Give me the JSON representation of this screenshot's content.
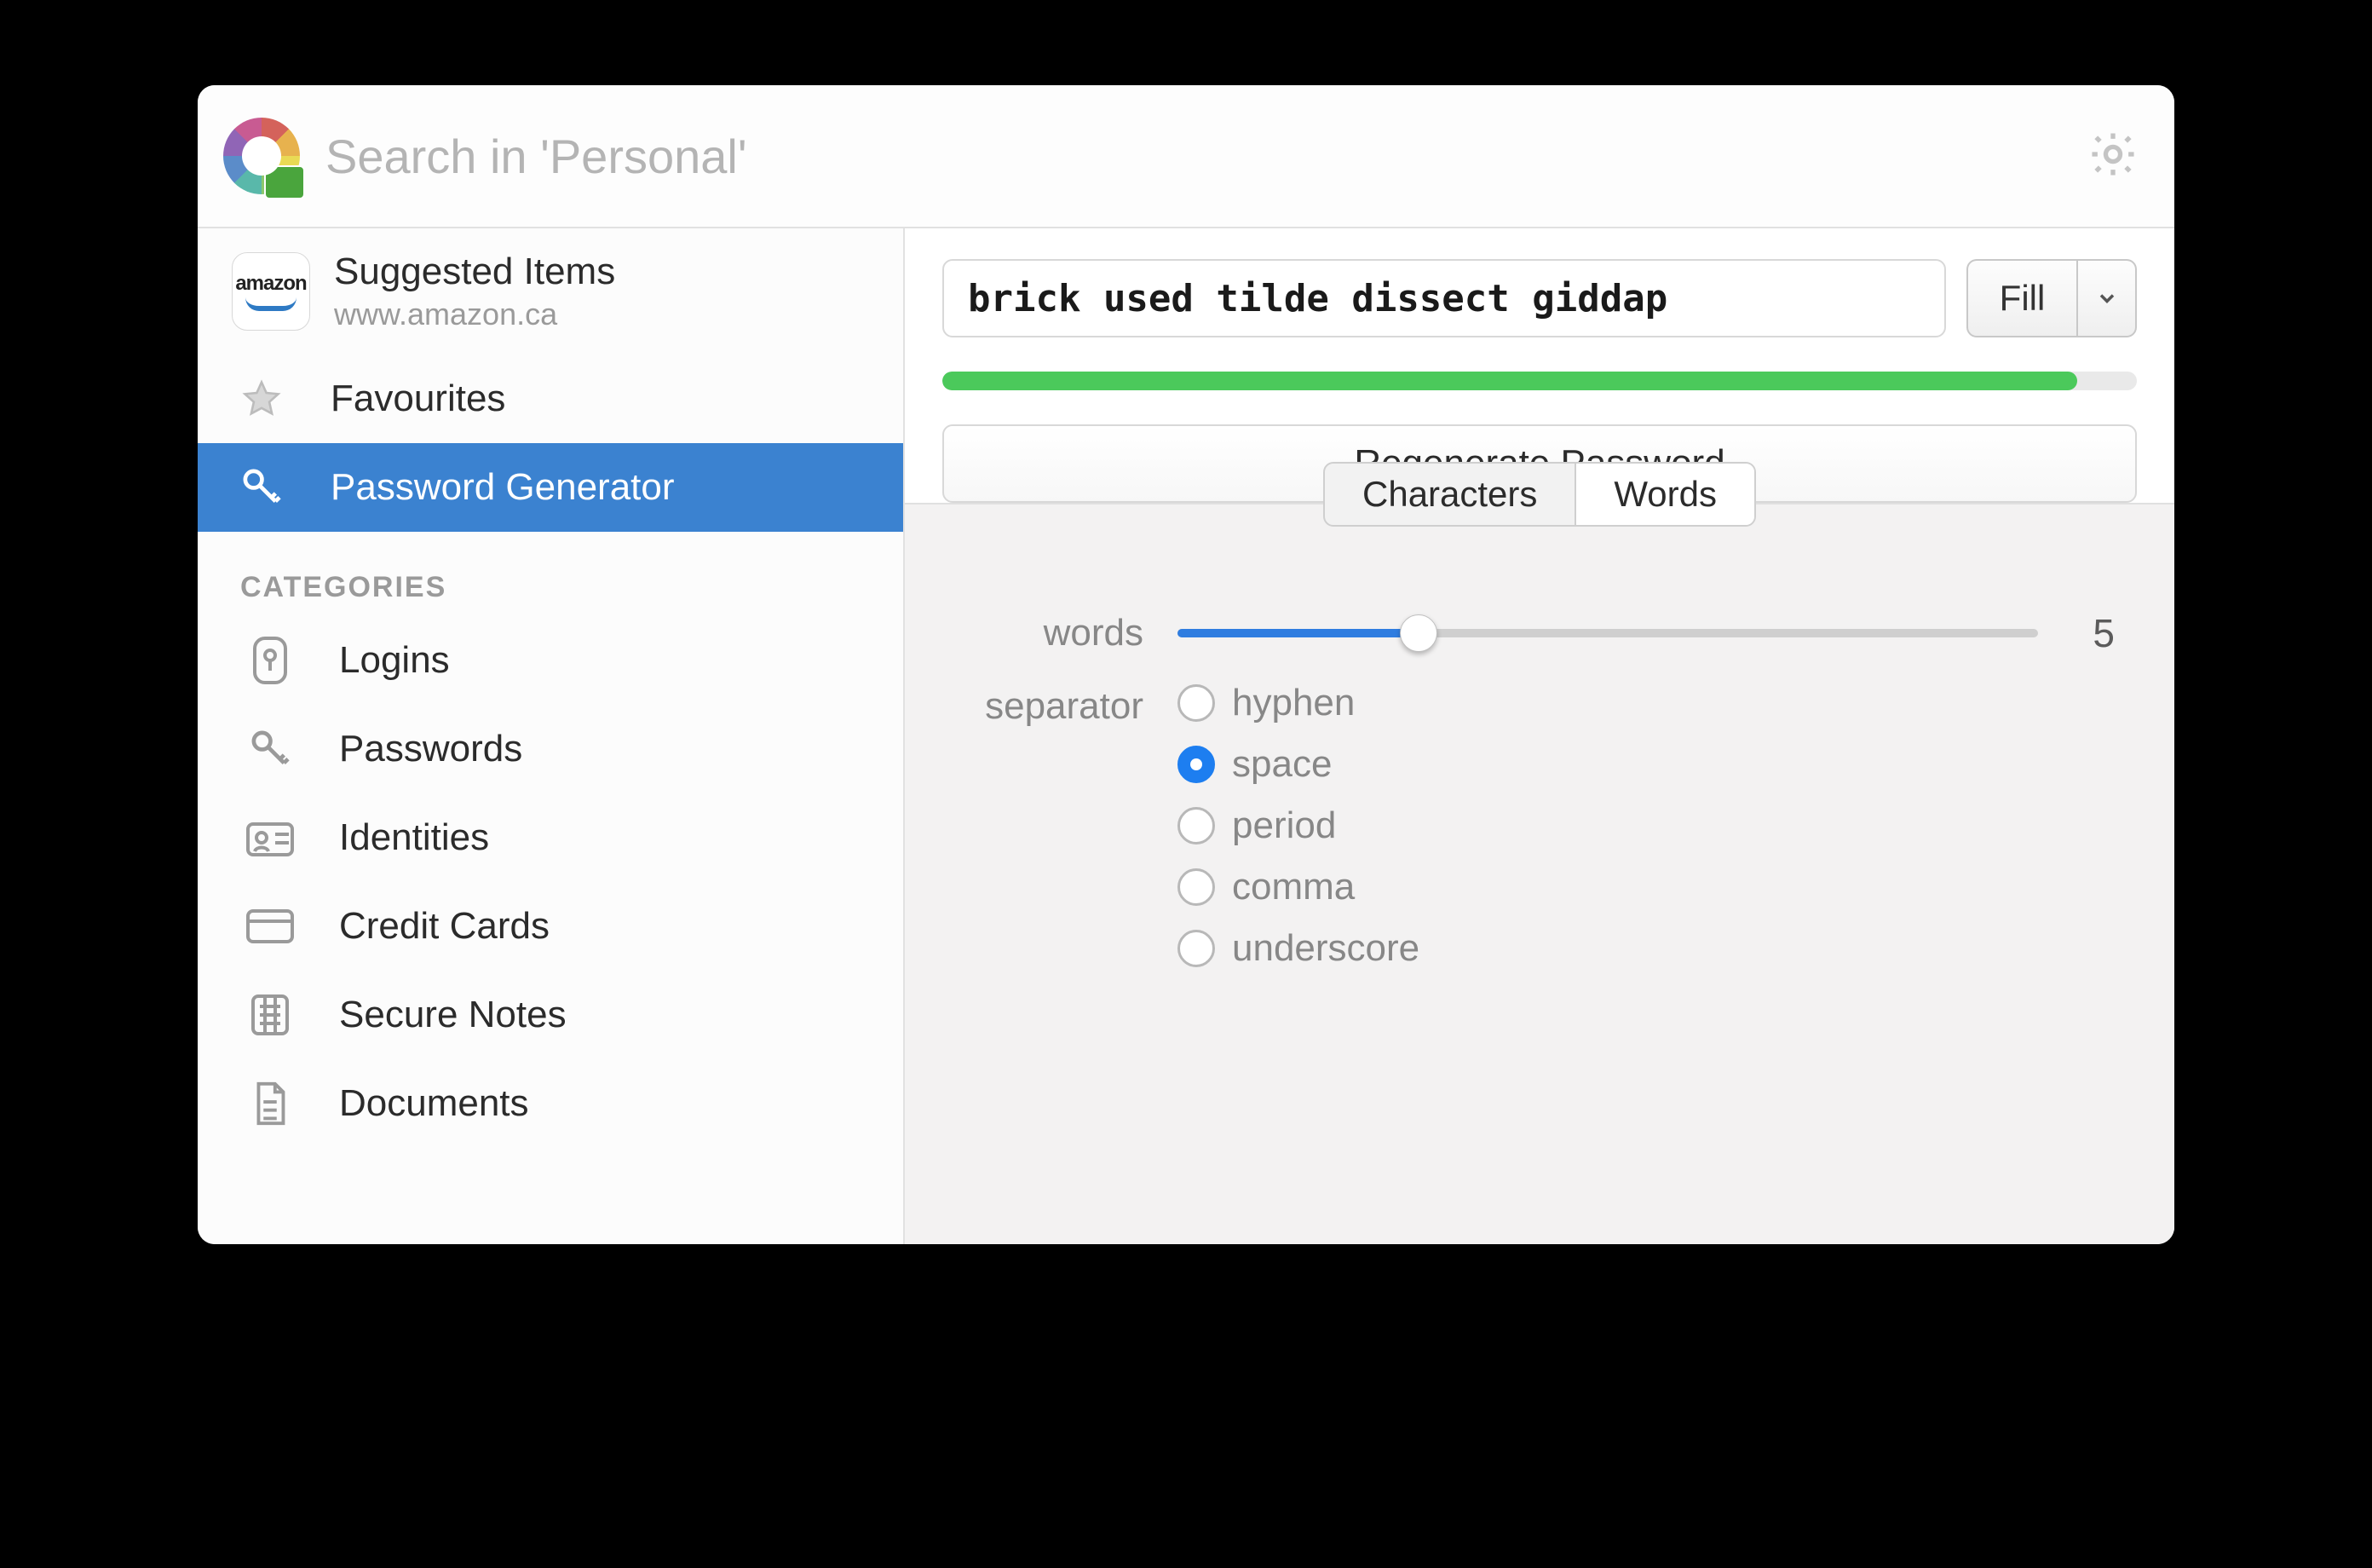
{
  "header": {
    "search_placeholder": "Search in 'Personal'"
  },
  "sidebar": {
    "suggested_title": "Suggested Items",
    "suggested_sub": "www.amazon.ca",
    "favourites_label": "Favourites",
    "generator_label": "Password Generator",
    "categories_header": "CATEGORIES",
    "categories": {
      "logins": "Logins",
      "passwords": "Passwords",
      "identities": "Identities",
      "credit_cards": "Credit Cards",
      "secure_notes": "Secure Notes",
      "documents": "Documents"
    }
  },
  "generator": {
    "password": "brick used tilde dissect giddap",
    "fill_label": "Fill",
    "strength_percent": 95,
    "regenerate_label": "Regenerate Password",
    "tabs": {
      "characters": "Characters",
      "words": "Words",
      "active": "words"
    },
    "words_label": "words",
    "words_value": "5",
    "words_slider_percent": 28,
    "separator_label": "separator",
    "separators": {
      "hyphen": "hyphen",
      "space": "space",
      "period": "period",
      "comma": "comma",
      "underscore": "underscore",
      "selected": "space"
    }
  }
}
